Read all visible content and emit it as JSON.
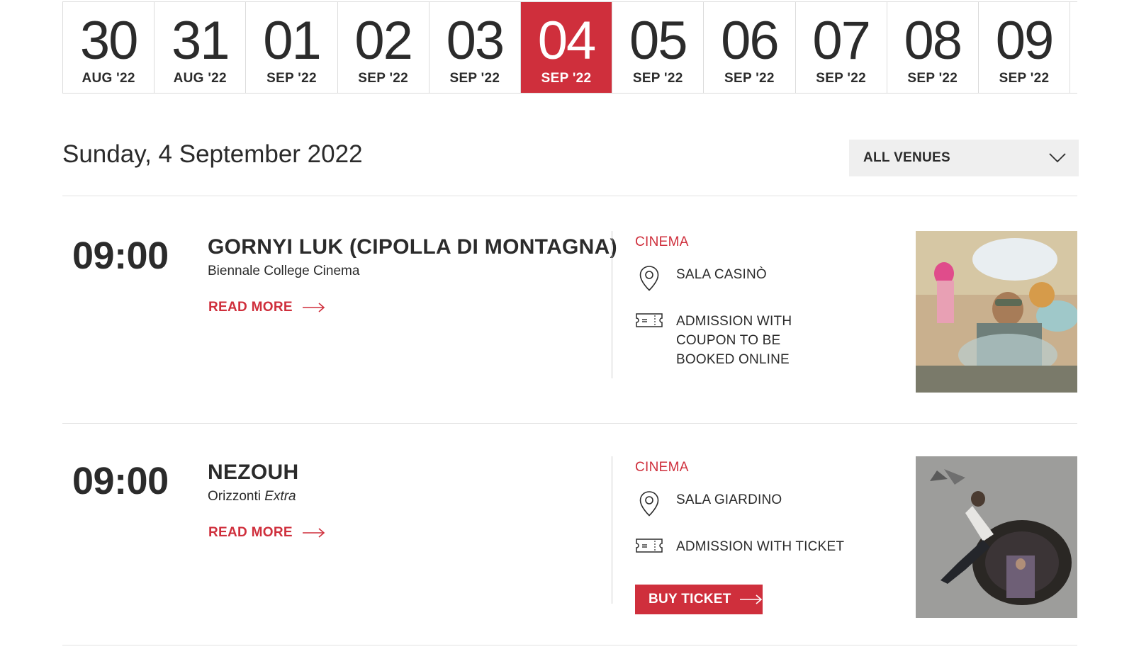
{
  "dates": [
    {
      "day": "30",
      "month": "AUG '22",
      "active": false
    },
    {
      "day": "31",
      "month": "AUG '22",
      "active": false
    },
    {
      "day": "01",
      "month": "SEP '22",
      "active": false
    },
    {
      "day": "02",
      "month": "SEP '22",
      "active": false
    },
    {
      "day": "03",
      "month": "SEP '22",
      "active": false
    },
    {
      "day": "04",
      "month": "SEP '22",
      "active": true
    },
    {
      "day": "05",
      "month": "SEP '22",
      "active": false
    },
    {
      "day": "06",
      "month": "SEP '22",
      "active": false
    },
    {
      "day": "07",
      "month": "SEP '22",
      "active": false
    },
    {
      "day": "08",
      "month": "SEP '22",
      "active": false
    },
    {
      "day": "09",
      "month": "SEP '22",
      "active": false
    }
  ],
  "heading": "Sunday, 4 September 2022",
  "venue_filter": {
    "selected": "ALL VENUES",
    "icon": "chevron-down-icon"
  },
  "colors": {
    "accent": "#cf2f3c",
    "text": "#2b2b2b",
    "filter_bg": "#efefef"
  },
  "events": [
    {
      "time": "09:00",
      "title": "GORNYI LUK (CIPOLLA DI MONTAGNA)",
      "section": "Biennale College Cinema",
      "read_more": "READ MORE",
      "category": "CINEMA",
      "venue": "SALA CASINÒ",
      "admission": "ADMISSION WITH COUPON TO BE BOOKED ONLINE"
    },
    {
      "time": "09:00",
      "title": "NEZOUH",
      "section_main": "Orizzonti",
      "section_italic": "Extra",
      "read_more": "READ MORE",
      "category": "CINEMA",
      "venue": "SALA GIARDINO",
      "admission": "ADMISSION WITH TICKET",
      "buy_label": "BUY TICKET"
    }
  ]
}
